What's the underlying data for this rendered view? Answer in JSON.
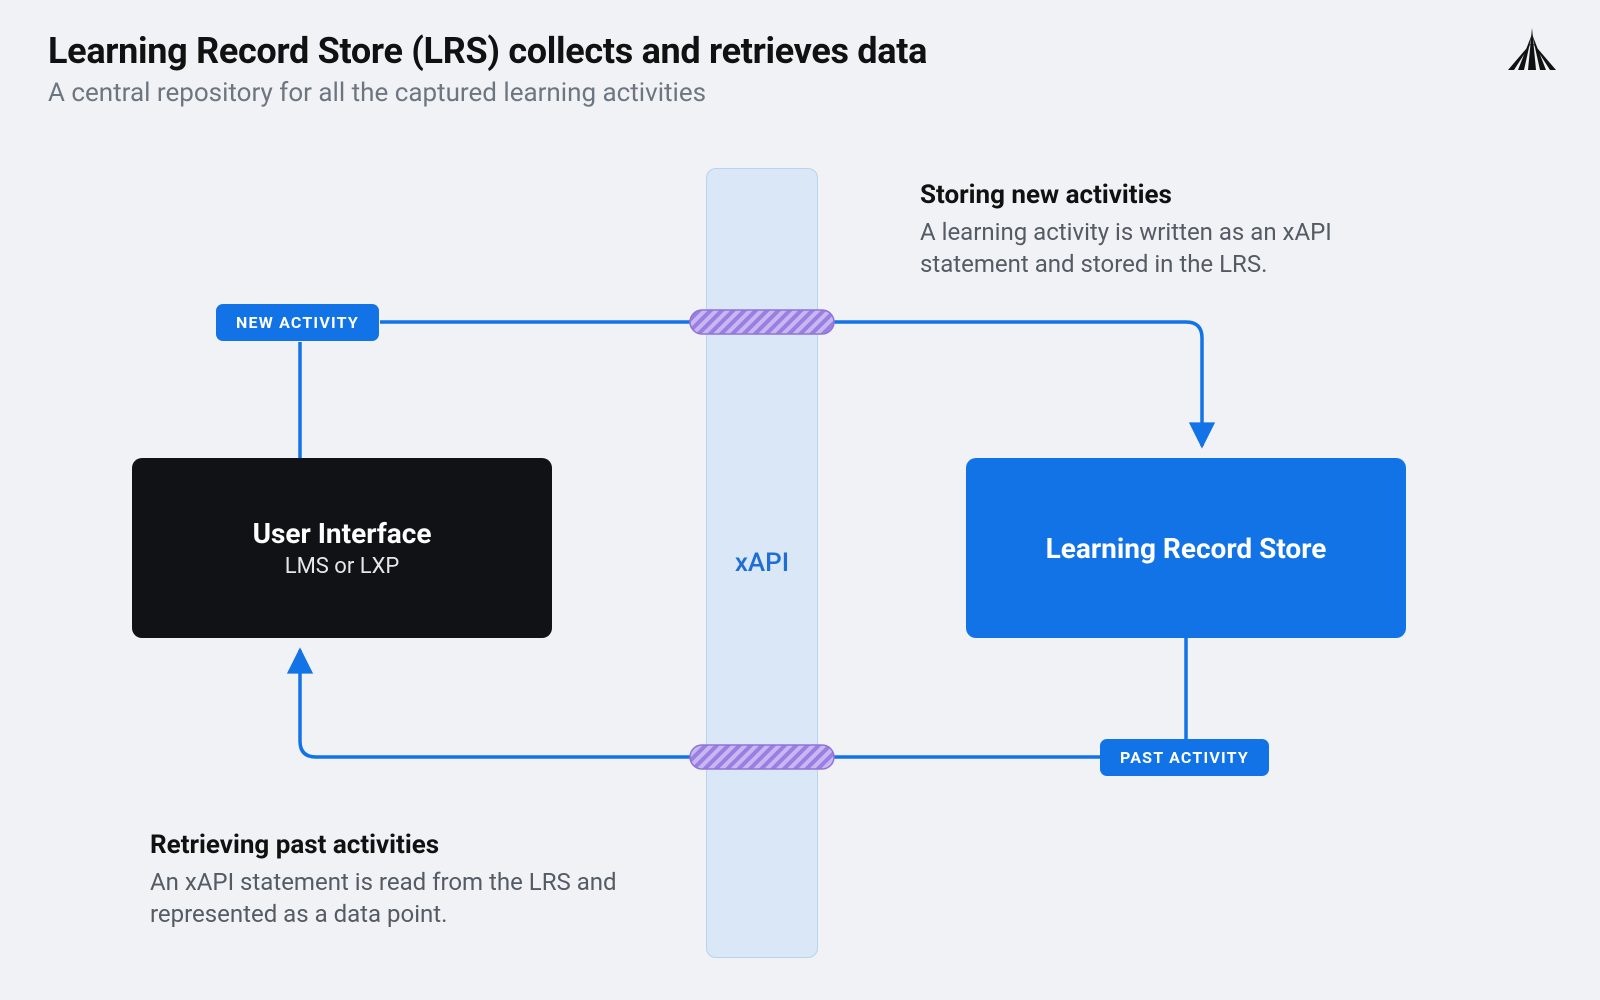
{
  "header": {
    "title": "Learning Record Store (LRS) collects and retrieves data",
    "subtitle": "A central repository for all the captured learning activities"
  },
  "xapi_column_label": "xAPI",
  "boxes": {
    "ui": {
      "title": "User Interface",
      "subtitle": "LMS or LXP"
    },
    "lrs": {
      "title": "Learning Record Store"
    }
  },
  "pills": {
    "new_activity": "NEW ACTIVITY",
    "past_activity": "PAST ACTIVITY"
  },
  "notes": {
    "storing": {
      "title": "Storing new activities",
      "body": "A learning activity is written as an xAPI statement and stored in the LRS."
    },
    "retrieving": {
      "title": "Retrieving past activities",
      "body": "An xAPI statement is read from the LRS and represented as a data point."
    }
  },
  "colors": {
    "accent_blue": "#1273e6",
    "xapi_fill": "#d9e7f6",
    "xapi_border": "#b9d3ee",
    "purple": "#9a7fe0",
    "black_box": "#101216",
    "page_bg": "#f0f2f5"
  }
}
